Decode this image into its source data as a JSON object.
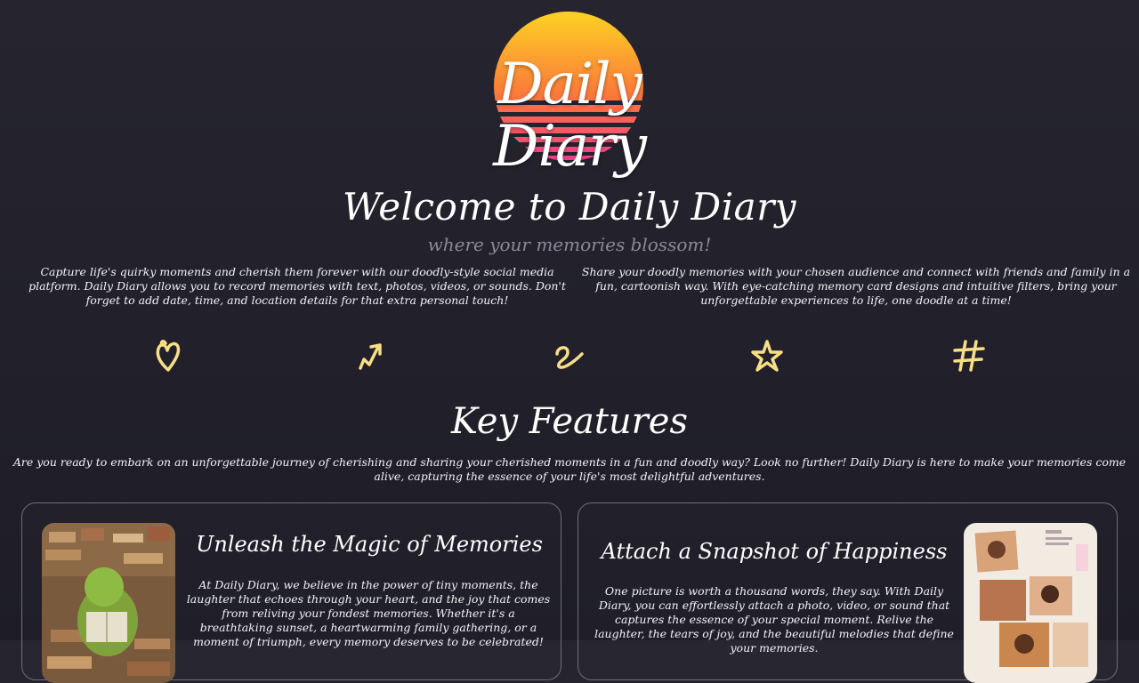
{
  "logo": {
    "text": "Daily Diary",
    "colors": {
      "sun_top": "#fcd323",
      "sun_mid": "#fb7a3a",
      "sun_bottom": "#f63b8c"
    }
  },
  "hero": {
    "title": "Welcome to Daily Diary",
    "subtitle": "where your memories blossom!"
  },
  "intro": {
    "left": "Capture life's quirky moments and cherish them forever with our doodly-style social media platform. Daily Diary allows you to record memories with text, photos, videos, or sounds. Don't forget to add date, time, and location details for that extra personal touch!",
    "right": "Share your doodly memories with your chosen audience and connect with friends and family in a fun, cartoonish way. With eye-catching memory card designs and intuitive filters, bring your unforgettable experiences to life, one doodle at a time!"
  },
  "doodles": {
    "color": "#f7df86",
    "icons": [
      "heart-doodle-icon",
      "arrow-doodle-icon",
      "swirl-doodle-icon",
      "star-doodle-icon",
      "hashtag-doodle-icon"
    ]
  },
  "features": {
    "title": "Key Features",
    "description": "Are you ready to embark on an unforgettable journey of cherishing and sharing your cherished moments in a fun and doodly way? Look no further! Daily Diary is here to make your memories come alive, capturing the essence of your life's most delightful adventures.",
    "cards": [
      {
        "title": "Unleash the Magic of Memories",
        "text": "At Daily Diary, we believe in the power of tiny moments, the laughter that echoes through your heart, and the joy that comes from reliving your fondest memories. Whether it's a breathtaking sunset, a heartwarming family gathering, or a moment of triumph, every memory deserves to be celebrated!"
      },
      {
        "title": "Attach a Snapshot of Happiness",
        "text": "One picture is worth a thousand words, they say. With Daily Diary, you can effortlessly attach a photo, video, or sound that captures the essence of your special moment. Relive the laughter, the tears of joy, and the beautiful melodies that define your memories."
      }
    ]
  }
}
